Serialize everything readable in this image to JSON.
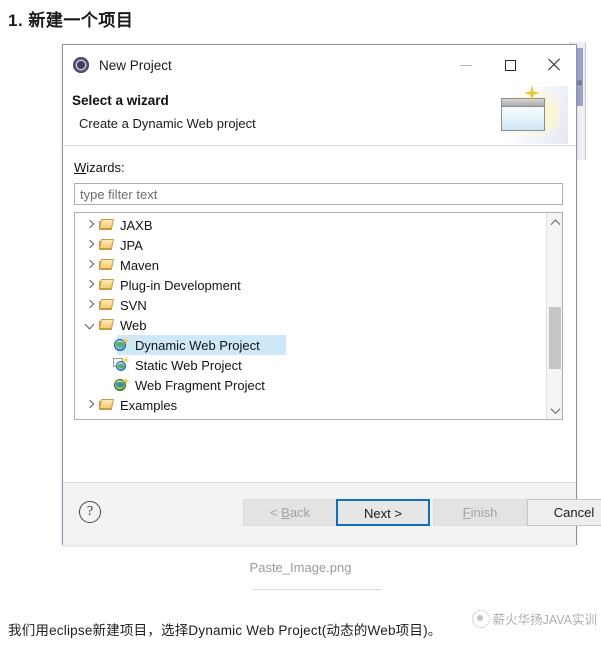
{
  "page": {
    "heading": "1. 新建一个项目",
    "caption": "Paste_Image.png",
    "footer_text": "我们用eclipse新建项目，选择Dynamic Web Project(动态的Web项目)。",
    "watermark": "薪火华扬JAVA实训",
    "bg_artifact_label": "ss"
  },
  "dialog": {
    "titlebar": {
      "icon": "eclipse-icon",
      "title": "New Project",
      "minimize_label": "minimize-icon",
      "maximize_label": "maximize-icon",
      "close_label": "close-icon"
    },
    "header": {
      "title": "Select a wizard",
      "description": "Create a Dynamic Web project",
      "banner_icon": "new-window-sparkle-icon"
    },
    "wizards_label_mnemonic": "W",
    "wizards_label_rest": "izards:",
    "filter": {
      "value": "",
      "placeholder": "type filter text"
    },
    "tree": [
      {
        "label": "JAXB",
        "icon": "folder-icon",
        "level": 0,
        "state": "collapsed",
        "selected": false
      },
      {
        "label": "JPA",
        "icon": "folder-icon",
        "level": 0,
        "state": "collapsed",
        "selected": false
      },
      {
        "label": "Maven",
        "icon": "folder-icon",
        "level": 0,
        "state": "collapsed",
        "selected": false
      },
      {
        "label": "Plug-in Development",
        "icon": "folder-icon",
        "level": 0,
        "state": "collapsed",
        "selected": false
      },
      {
        "label": "SVN",
        "icon": "folder-icon",
        "level": 0,
        "state": "collapsed",
        "selected": false
      },
      {
        "label": "Web",
        "icon": "folder-icon",
        "level": 0,
        "state": "expanded",
        "selected": false
      },
      {
        "label": "Dynamic Web Project",
        "icon": "dynamic-web-project-icon",
        "level": 1,
        "state": "leaf",
        "selected": true
      },
      {
        "label": "Static Web Project",
        "icon": "static-web-project-icon",
        "level": 1,
        "state": "leaf",
        "selected": false
      },
      {
        "label": "Web Fragment Project",
        "icon": "web-fragment-project-icon",
        "level": 1,
        "state": "leaf",
        "selected": false
      },
      {
        "label": "Examples",
        "icon": "folder-icon",
        "level": 0,
        "state": "collapsed",
        "selected": false
      }
    ],
    "scrollbar": {
      "up_arrow": "scroll-up-icon",
      "down_arrow": "scroll-down-icon"
    },
    "footer": {
      "help_label": "?",
      "buttons": [
        {
          "id": "back",
          "pre": "< ",
          "mnemonic": "B",
          "post": "ack",
          "state": "disabled"
        },
        {
          "id": "next",
          "pre": "",
          "mnemonic": "",
          "post": "Next >",
          "state": "focused"
        },
        {
          "id": "finish",
          "pre": "",
          "mnemonic": "F",
          "post": "inish",
          "state": "disabled"
        },
        {
          "id": "cancel",
          "pre": "",
          "mnemonic": "",
          "post": "Cancel",
          "state": "enabled"
        }
      ]
    }
  },
  "colors": {
    "selection": "#cde8f7",
    "focus_border": "#0b6fc4",
    "dialog_border": "#8f8fb0"
  }
}
